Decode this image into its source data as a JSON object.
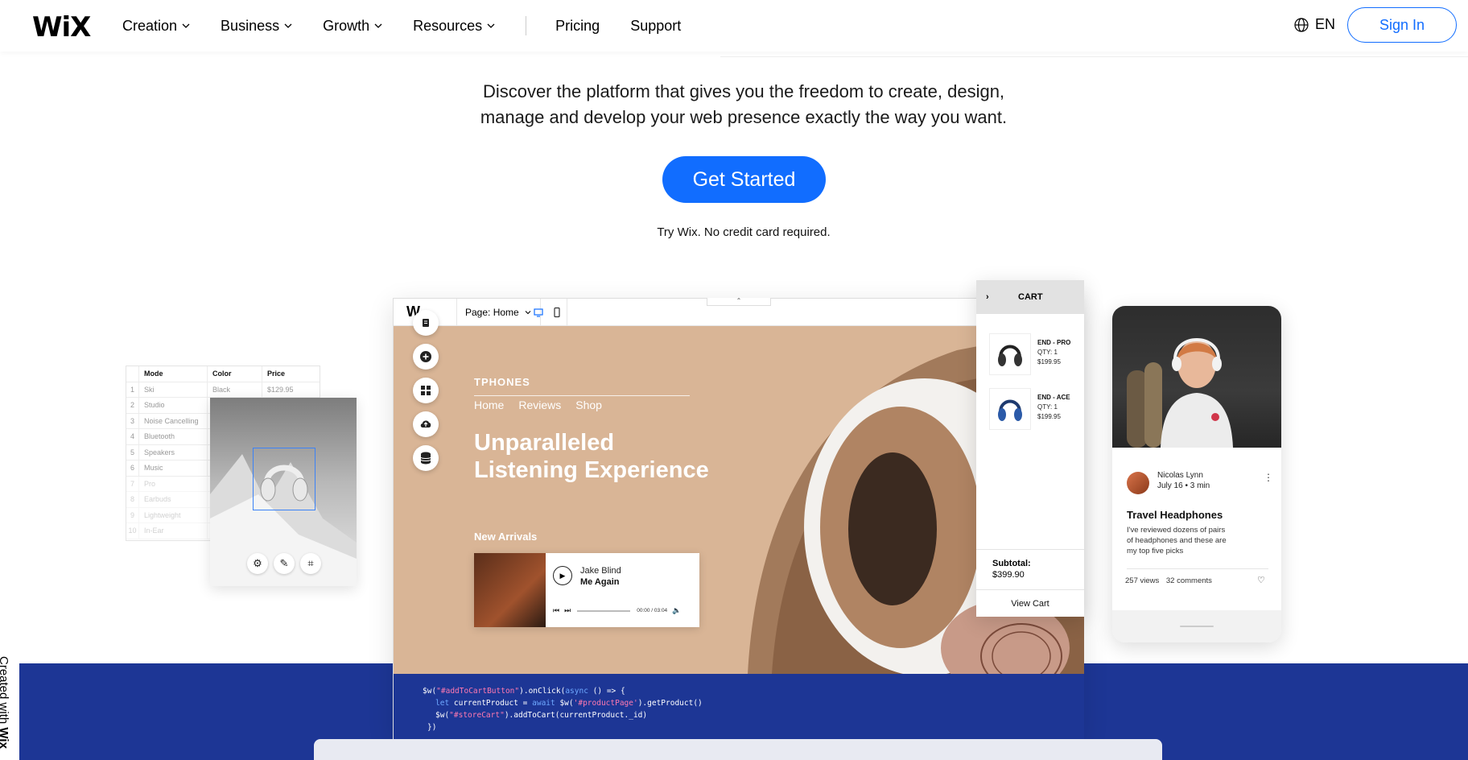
{
  "header": {
    "logo": "WiX",
    "nav": [
      {
        "label": "Creation",
        "dropdown": true
      },
      {
        "label": "Business",
        "dropdown": true
      },
      {
        "label": "Growth",
        "dropdown": true
      },
      {
        "label": "Resources",
        "dropdown": true
      }
    ],
    "links": [
      {
        "label": "Pricing"
      },
      {
        "label": "Support"
      }
    ],
    "lang": "EN",
    "signin": "Sign In"
  },
  "hero": {
    "desc_line1": "Discover the platform that gives you the freedom to create, design,",
    "desc_line2": "manage and develop your web presence exactly the way you want.",
    "cta": "Get Started",
    "note": "Try Wix. No credit card required."
  },
  "sheet": {
    "headers": [
      "Mode",
      "Color",
      "Price"
    ],
    "rows": [
      {
        "n": "1",
        "mode": "Ski",
        "color": "Black",
        "price": "$129.95"
      },
      {
        "n": "2",
        "mode": "Studio",
        "color": "",
        "price": ""
      },
      {
        "n": "3",
        "mode": "Noise Cancelling",
        "color": "",
        "price": ""
      },
      {
        "n": "4",
        "mode": "Bluetooth",
        "color": "",
        "price": ""
      },
      {
        "n": "5",
        "mode": "Speakers",
        "color": "",
        "price": ""
      },
      {
        "n": "6",
        "mode": "Music",
        "color": "",
        "price": ""
      },
      {
        "n": "7",
        "mode": "Pro",
        "color": "",
        "price": ""
      },
      {
        "n": "8",
        "mode": "Earbuds",
        "color": "",
        "price": ""
      },
      {
        "n": "9",
        "mode": "Lightweight",
        "color": "",
        "price": ""
      },
      {
        "n": "10",
        "mode": "In-Ear",
        "color": "",
        "price": ""
      }
    ]
  },
  "editor": {
    "logo": "W",
    "page_label": "Page: Home",
    "site": {
      "brand": "TPHONES",
      "nav": [
        "Home",
        "Reviews",
        "Shop"
      ],
      "headline_line1": "Unparalleled",
      "headline_line2": "Listening Experience",
      "new_arrivals": "New Arrivals"
    },
    "player": {
      "artist": "Jake Blind",
      "song": "Me Again",
      "time": "00:00 / 03:04"
    },
    "code": {
      "l1_a": "$w(",
      "l1_b": "\"#addToCartButton\"",
      "l1_c": ").onClick(",
      "l1_d": "async",
      "l1_e": " () => {",
      "l2_a": "let",
      "l2_b": " currentProduct = ",
      "l2_c": "await",
      "l2_d": " $w(",
      "l2_e": "'#productPage'",
      "l2_f": ").getProduct()",
      "l3_a": "$w(",
      "l3_b": "\"#storeCart\"",
      "l3_c": ").addToCart(currentProduct._id)",
      "l4": "})"
    }
  },
  "cart": {
    "title": "CART",
    "items": [
      {
        "name": "END - PRO",
        "qty": "QTY: 1",
        "price": "$199.95"
      },
      {
        "name": "END - ACE",
        "qty": "QTY: 1",
        "price": "$199.95"
      }
    ],
    "subtotal_label": "Subtotal:",
    "subtotal": "$399.90",
    "view_cart": "View Cart"
  },
  "blog": {
    "author": "Nicolas Lynn",
    "date": "July 16 •  3 min",
    "title": "Travel Headphones",
    "excerpt": "I've reviewed dozens of pairs of headphones and these are my top five picks",
    "views": "257 views",
    "comments": "32 comments"
  },
  "badge": {
    "prefix": "Created with ",
    "brand": "Wix"
  },
  "colors": {
    "accent": "#116dff",
    "band": "#1d3695",
    "editor_canvas": "#d9b596"
  }
}
